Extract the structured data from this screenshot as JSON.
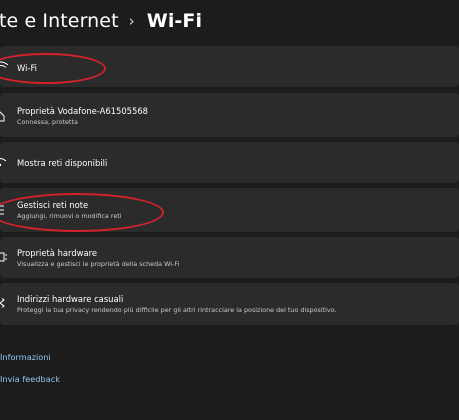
{
  "breadcrumb": {
    "parent": "te e Internet",
    "separator": "›",
    "current": "Wi-Fi"
  },
  "items": [
    {
      "icon": "wifi-icon",
      "title": "Wi-Fi",
      "subtitle": ""
    },
    {
      "icon": "home-network-icon",
      "title": "Proprietà Vodafone-A61505568",
      "subtitle": "Connessa, protetta"
    },
    {
      "icon": "wifi-scan-icon",
      "title": "Mostra reti disponibili",
      "subtitle": ""
    },
    {
      "icon": "list-icon",
      "title": "Gestisci reti note",
      "subtitle": "Aggiungi, rimuovi o modifica reti"
    },
    {
      "icon": "chip-icon",
      "title": "Proprietà hardware",
      "subtitle": "Visualizza e gestisci le proprietà della scheda Wi-Fi"
    },
    {
      "icon": "shuffle-icon",
      "title": "Indirizzi hardware casuali",
      "subtitle": "Proteggi la tua privacy rendendo più difficile per gli altri rintracciare la posizione del tuo dispositivo."
    }
  ],
  "links": {
    "info": "Informazioni",
    "feedback": "Invia feedback"
  },
  "colors": {
    "background": "#1c1c1c",
    "card": "#2b2b2b",
    "annotation": "#d3222a",
    "link": "#8fc8f2"
  }
}
